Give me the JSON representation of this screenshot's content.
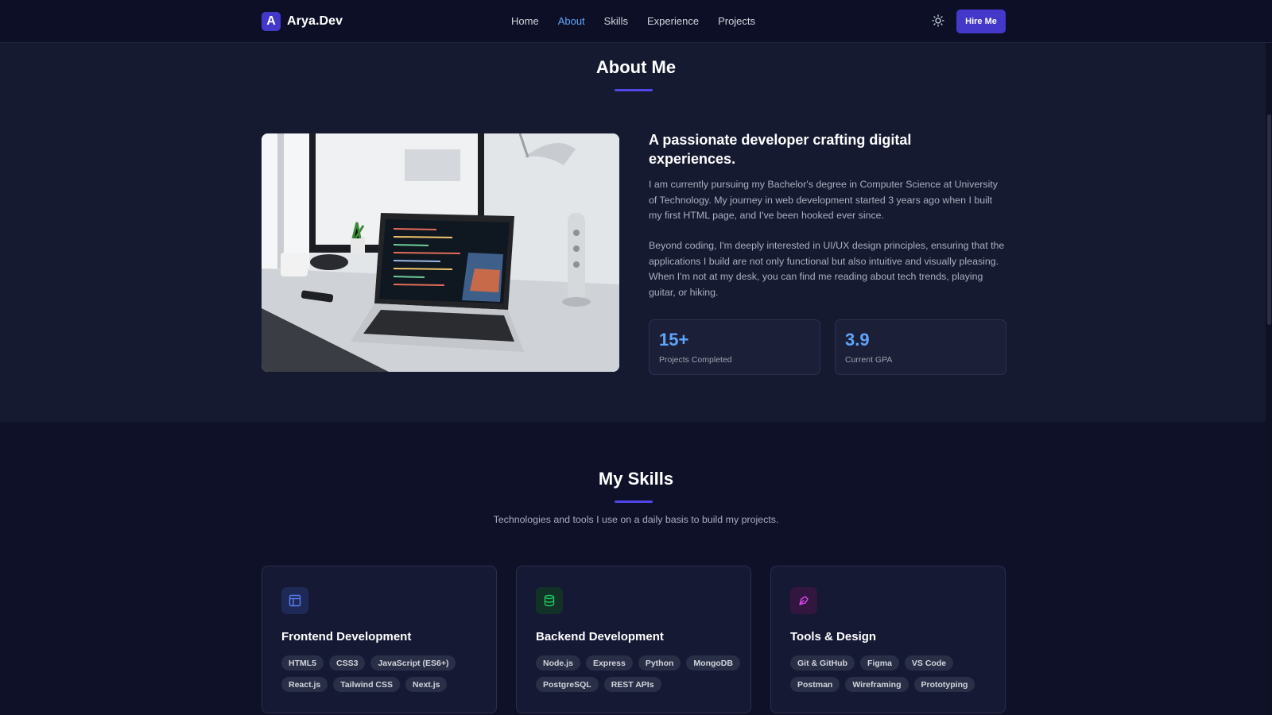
{
  "nav": {
    "brand_letter": "A",
    "brand_name": "Arya.Dev",
    "links": [
      "Home",
      "About",
      "Skills",
      "Experience",
      "Projects"
    ],
    "active_link": "About",
    "theme_icon": "sun-icon",
    "hire_label": "Hire Me"
  },
  "about": {
    "title": "About Me",
    "heading": "A passionate developer crafting digital experiences.",
    "paragraph1": "I am currently pursuing my Bachelor's degree in Computer Science at University of Technology. My journey in web development started 3 years ago when I built my first HTML page, and I've been hooked ever since.",
    "paragraph2": "Beyond coding, I'm deeply interested in UI/UX design principles, ensuring that the applications I build are not only functional but also intuitive and visually pleasing. When I'm not at my desk, you can find me reading about tech trends, playing guitar, or hiking.",
    "stats": [
      {
        "value": "15+",
        "label": "Projects Completed"
      },
      {
        "value": "3.9",
        "label": "Current GPA"
      }
    ]
  },
  "skills": {
    "title": "My Skills",
    "subtitle": "Technologies and tools I use on a daily basis to build my projects.",
    "cards": [
      {
        "title": "Frontend Development",
        "icon": "layout-icon",
        "tags": [
          "HTML5",
          "CSS3",
          "JavaScript (ES6+)",
          "React.js",
          "Tailwind CSS",
          "Next.js"
        ]
      },
      {
        "title": "Backend Development",
        "icon": "database-icon",
        "tags": [
          "Node.js",
          "Express",
          "Python",
          "MongoDB",
          "PostgreSQL",
          "REST APIs"
        ]
      },
      {
        "title": "Tools & Design",
        "icon": "pen-tool-icon",
        "tags": [
          "Git & GitHub",
          "Figma",
          "VS Code",
          "Postman",
          "Wireframing",
          "Prototyping"
        ]
      }
    ]
  },
  "colors": {
    "accent": "#4338ca",
    "link_active": "#60a5fa",
    "frontend_icon": "#4f6cf0",
    "backend_icon": "#22c55e",
    "design_icon": "#c026d3"
  }
}
